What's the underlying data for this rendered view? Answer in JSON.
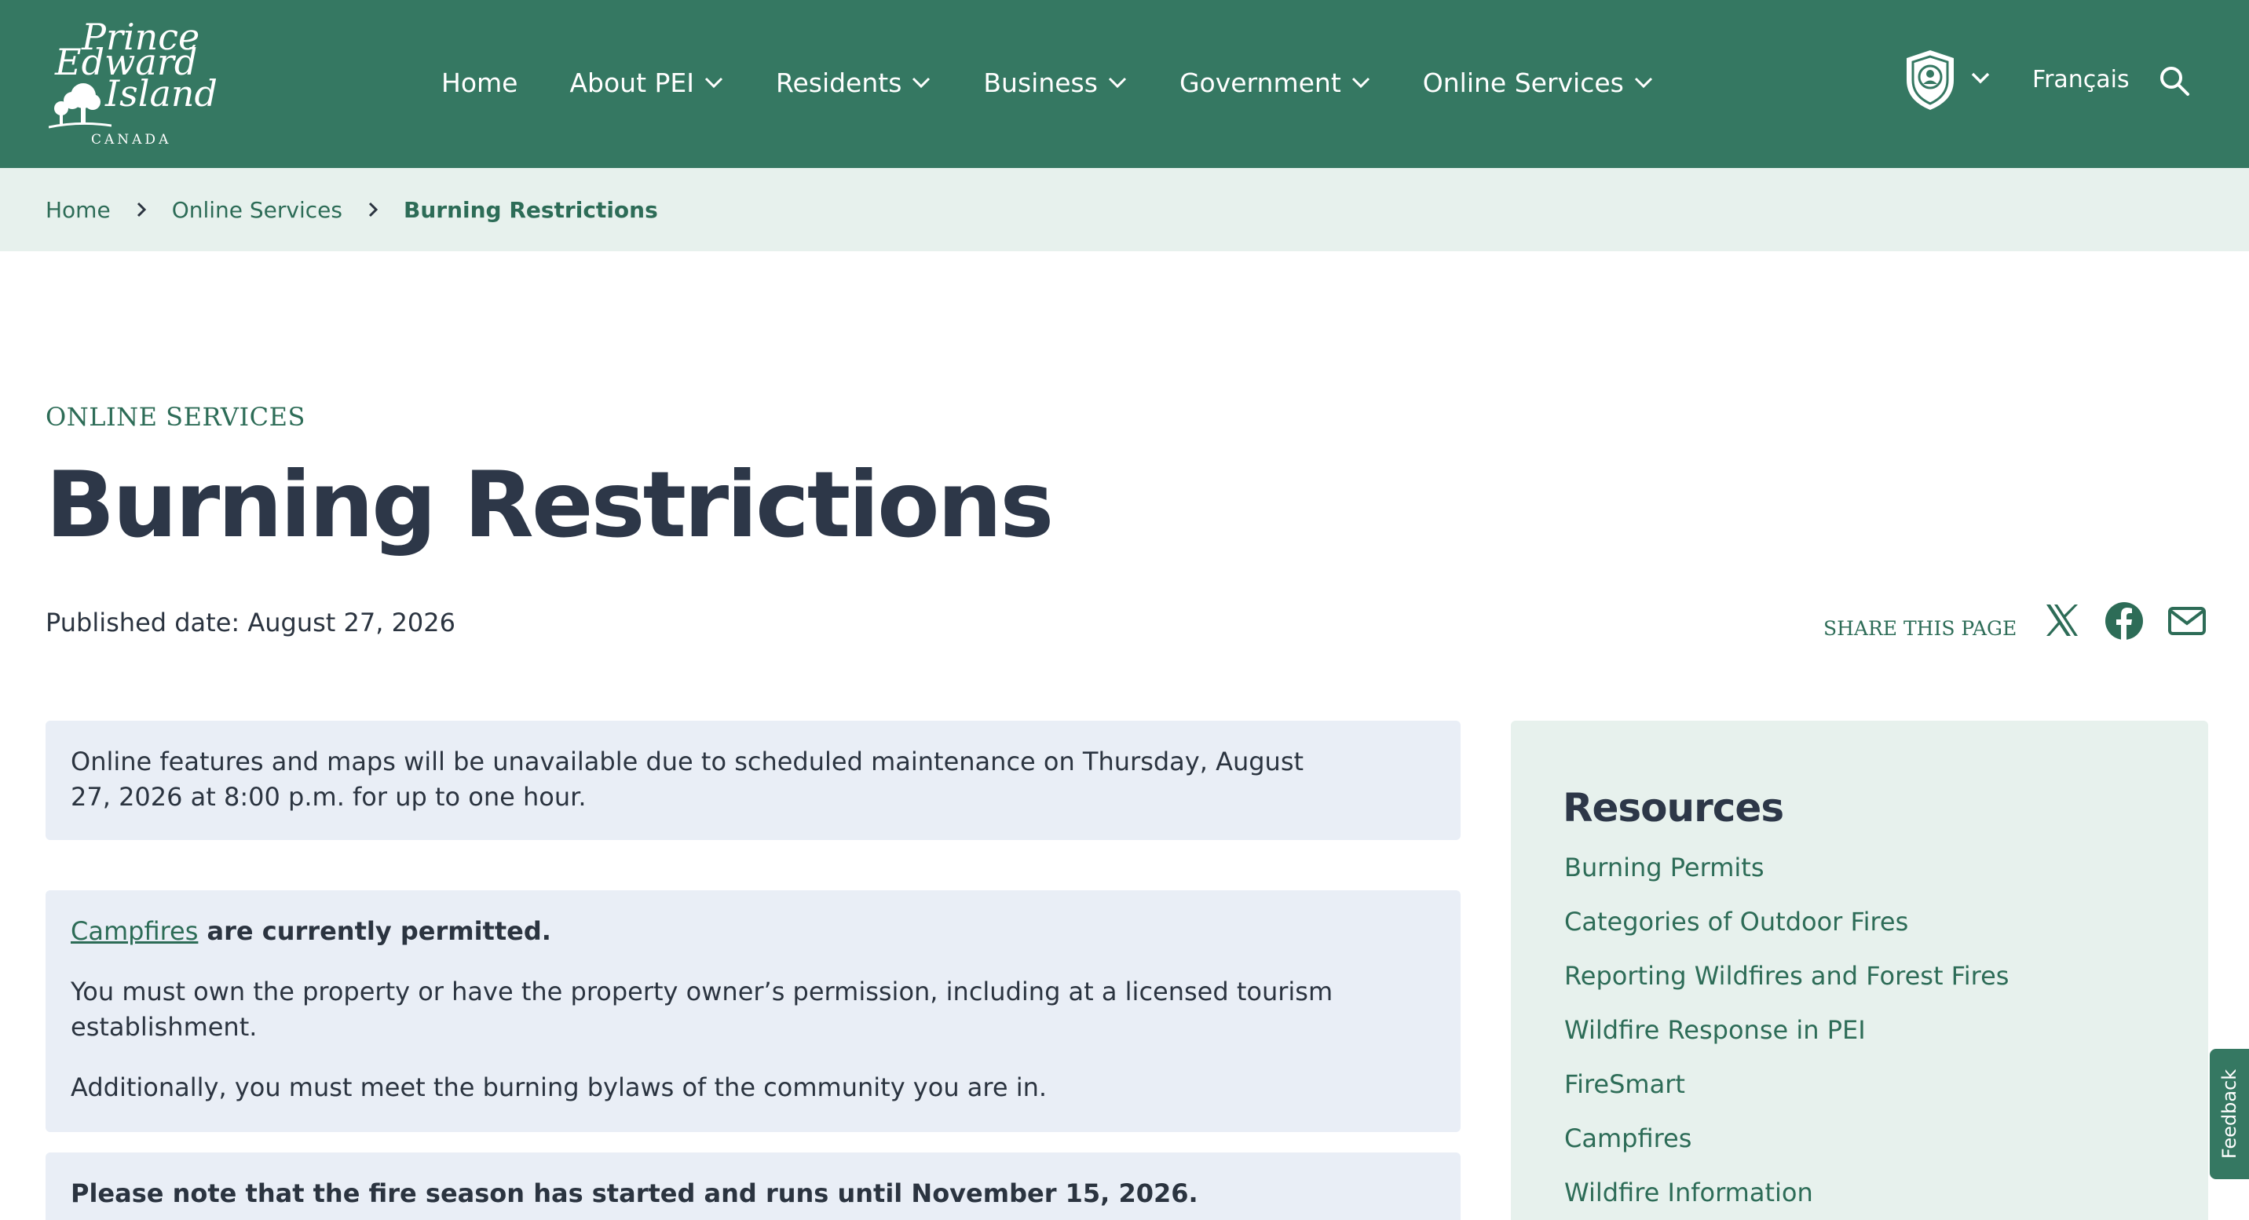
{
  "header": {
    "logo": {
      "line1": "Prince",
      "line2": "Edward",
      "line3": "Island",
      "country": "CANADA"
    },
    "nav": [
      {
        "label": "Home",
        "has_dropdown": false
      },
      {
        "label": "About PEI",
        "has_dropdown": true
      },
      {
        "label": "Residents",
        "has_dropdown": true
      },
      {
        "label": "Business",
        "has_dropdown": true
      },
      {
        "label": "Government",
        "has_dropdown": true
      },
      {
        "label": "Online Services",
        "has_dropdown": true
      }
    ],
    "account_icon": "shield-user-icon",
    "language_label": "Français",
    "search_icon": "search-icon"
  },
  "breadcrumb": {
    "items": [
      "Home",
      "Online Services"
    ],
    "current": "Burning Restrictions"
  },
  "page": {
    "eyebrow": "ONLINE SERVICES",
    "title": "Burning Restrictions",
    "published": "Published date: August 27, 2026",
    "share_label": "SHARE THIS PAGE",
    "share_icons": [
      "x-icon",
      "facebook-icon",
      "email-icon"
    ]
  },
  "alerts": {
    "maintenance": "Online features and maps will be unavailable due to scheduled maintenance on Thursday, August 27, 2026 at 8:00 p.m. for up to one hour.",
    "campfire_link": "Campfires",
    "campfire_status": " are currently permitted.",
    "property": "You must own the property or have the property owner’s permission, including at a licensed tourism establishment.",
    "bylaws": "Additionally, you must meet the burning bylaws of the community you are in.",
    "fire_season": "Please note that the fire season has started and runs until November 15, 2026."
  },
  "sidebar": {
    "title": "Resources",
    "links": [
      "Burning Permits",
      "Categories of Outdoor Fires",
      "Reporting Wildfires and Forest Fires",
      "Wildfire Response in PEI",
      "FireSmart",
      "Campfires",
      "Wildfire Information"
    ]
  },
  "feedback_label": "Feedback",
  "colors": {
    "brand_green": "#357862",
    "link_green": "#2d6c57",
    "breadcrumb_bg": "#e7f1ed",
    "alert_bg": "#e9eef6",
    "heading": "#2d3748"
  }
}
